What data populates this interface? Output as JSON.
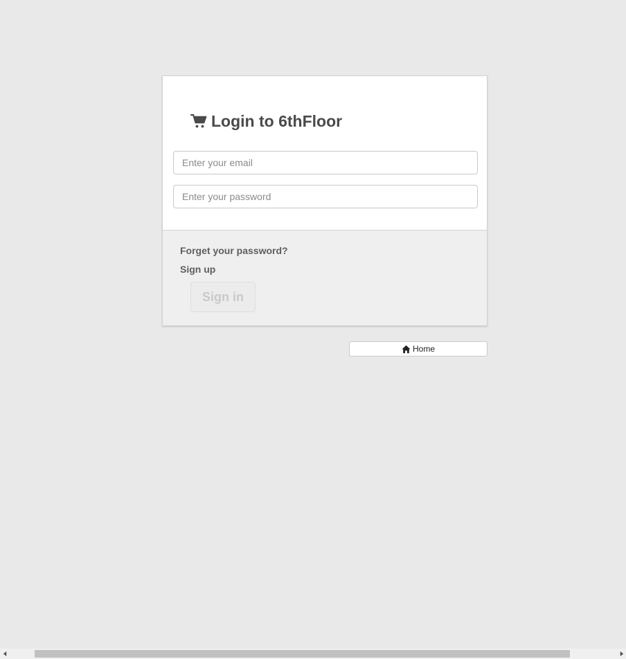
{
  "login": {
    "title": "Login to 6thFloor",
    "title_icon": "shopping-cart-icon",
    "email_placeholder": "Enter your email",
    "email_value": "",
    "password_placeholder": "Enter your password",
    "password_value": "",
    "forgot_password_label": "Forget your password?",
    "sign_up_label": "Sign up",
    "sign_in_label": "Sign in",
    "sign_in_disabled": true
  },
  "nav": {
    "home_label": "Home",
    "home_icon": "home-icon"
  },
  "colors": {
    "page_background": "#e9e9e9",
    "card_background": "#ffffff",
    "card_footer_background": "#efefef",
    "title_text": "#4a4a4a",
    "link_text": "#5e5e5e",
    "disabled_button_text": "#c9c9c9"
  }
}
